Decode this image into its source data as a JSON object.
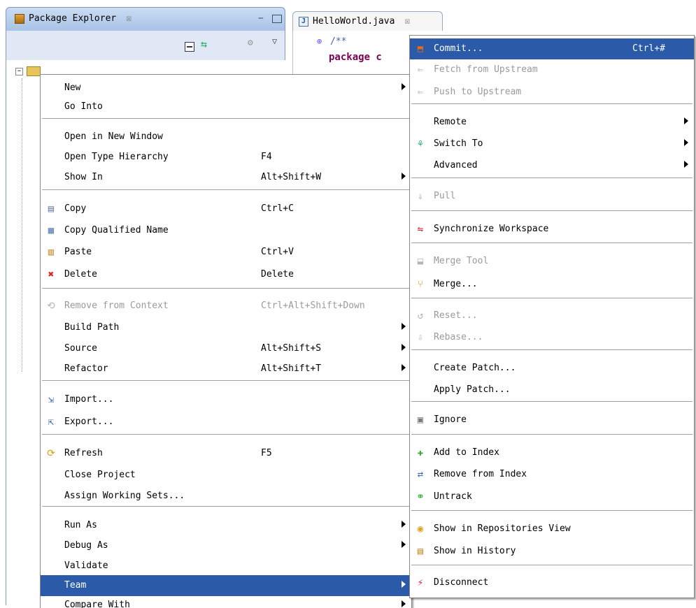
{
  "package_explorer": {
    "title": "Package Explorer",
    "close": "☒",
    "minimize": "−"
  },
  "editor": {
    "tab_label": "HelloWorld.java",
    "tab_close": "☒",
    "java_icon": "J",
    "comment": "/**",
    "package_keyword": "package c"
  },
  "context_menu": {
    "items": [
      {
        "label": "New",
        "submenu": true
      },
      {
        "label": "Go Into"
      },
      {
        "label": "Open in New Window"
      },
      {
        "label": "Open Type Hierarchy",
        "shortcut": "F4"
      },
      {
        "label": "Show In",
        "shortcut": "Alt+Shift+W",
        "submenu": true
      },
      {
        "label": "Copy",
        "shortcut": "Ctrl+C",
        "icon": "copy-icon"
      },
      {
        "label": "Copy Qualified Name",
        "icon": "copy-qualified-name-icon"
      },
      {
        "label": "Paste",
        "shortcut": "Ctrl+V",
        "icon": "paste-icon"
      },
      {
        "label": "Delete",
        "shortcut": "Delete",
        "icon": "delete-icon"
      },
      {
        "label": "Remove from Context",
        "shortcut": "Ctrl+Alt+Shift+Down",
        "disabled": true,
        "icon": "remove-context-icon"
      },
      {
        "label": "Build Path",
        "submenu": true
      },
      {
        "label": "Source",
        "shortcut": "Alt+Shift+S",
        "submenu": true
      },
      {
        "label": "Refactor",
        "shortcut": "Alt+Shift+T",
        "submenu": true
      },
      {
        "label": "Import...",
        "icon": "import-icon"
      },
      {
        "label": "Export...",
        "icon": "export-icon"
      },
      {
        "label": "Refresh",
        "shortcut": "F5",
        "icon": "refresh-icon"
      },
      {
        "label": "Close Project"
      },
      {
        "label": "Assign Working Sets..."
      },
      {
        "label": "Run As",
        "submenu": true
      },
      {
        "label": "Debug As",
        "submenu": true
      },
      {
        "label": "Validate"
      },
      {
        "label": "Team",
        "submenu": true,
        "selected": true
      },
      {
        "label": "Compare With",
        "submenu": true
      }
    ]
  },
  "team_menu": {
    "items": [
      {
        "label": "Commit...",
        "shortcut": "Ctrl+#",
        "selected": true,
        "icon": "commit-icon"
      },
      {
        "label": "Fetch from Upstream",
        "disabled": true,
        "icon": "fetch-icon"
      },
      {
        "label": "Push to Upstream",
        "disabled": true,
        "icon": "push-icon"
      },
      {
        "label": "Remote",
        "submenu": true
      },
      {
        "label": "Switch To",
        "submenu": true,
        "icon": "switch-branch-icon"
      },
      {
        "label": "Advanced",
        "submenu": true
      },
      {
        "label": "Pull",
        "disabled": true,
        "icon": "pull-icon"
      },
      {
        "label": "Synchronize Workspace",
        "icon": "synchronize-icon"
      },
      {
        "label": "Merge Tool",
        "disabled": true,
        "icon": "merge-tool-icon"
      },
      {
        "label": "Merge...",
        "icon": "merge-icon"
      },
      {
        "label": "Reset...",
        "disabled": true,
        "icon": "reset-icon"
      },
      {
        "label": "Rebase...",
        "disabled": true,
        "icon": "rebase-icon"
      },
      {
        "label": "Create Patch..."
      },
      {
        "label": "Apply Patch..."
      },
      {
        "label": "Ignore",
        "icon": "ignore-icon"
      },
      {
        "label": "Add to Index",
        "icon": "add-index-icon"
      },
      {
        "label": "Remove from Index",
        "icon": "remove-index-icon"
      },
      {
        "label": "Untrack",
        "icon": "untrack-icon"
      },
      {
        "label": "Show in Repositories View",
        "icon": "repositories-icon"
      },
      {
        "label": "Show in History",
        "icon": "history-icon"
      },
      {
        "label": "Disconnect",
        "icon": "disconnect-icon"
      }
    ]
  },
  "colors": {
    "selection": "#2a5aa8",
    "disabled_text": "#9a9a9a",
    "tab_active": "#a9c3e6"
  }
}
